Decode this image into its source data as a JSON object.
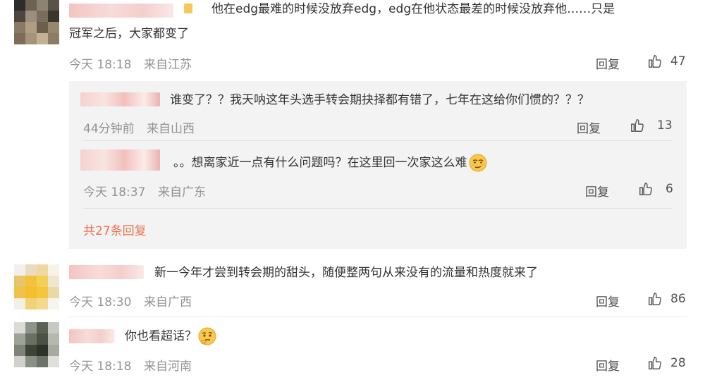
{
  "comments": [
    {
      "text_line1": "他在edg最难的时候没放弃edg，edg在他状态最差的时候没放弃他……只是",
      "text_line2": "冠军之后，大家都变了",
      "time": "今天 18:18",
      "location": "来自江苏",
      "reply_label": "回复",
      "likes": "47",
      "avatar_colors": [
        "#2c2c2c",
        "#6e6252",
        "#8c8373",
        "#5a5248",
        "#4d463e",
        "#9a8f7d",
        "#7a6d5e",
        "#3a352f",
        "#8a7a64",
        "#b09d82",
        "#6d5d4d",
        "#98876f",
        "#7d6c58",
        "#a59479",
        "#c2b194",
        "#8e7d66"
      ],
      "replies": [
        {
          "text": "谁变了？？我天呐这年头选手转会期抉择都有错了，七年在这给你们惯的？？？",
          "time": "44分钟前",
          "location": "来自山西",
          "reply_label": "回复",
          "likes": "13"
        },
        {
          "text": "。。想离家近一点有什么问题吗？在这里回一次家这么难",
          "emoji": "smirk-emoji",
          "time": "今天 18:37",
          "location": "来自广东",
          "reply_label": "回复",
          "likes": "6"
        }
      ],
      "more_replies": "共27条回复"
    },
    {
      "text": "新一今年才尝到转会期的甜头，随便整两句从来没有的流量和热度就来了",
      "time": "今天 18:30",
      "location": "来自广西",
      "reply_label": "回复",
      "likes": "86",
      "avatar_colors": [
        "#f2f0ea",
        "#e8dcc0",
        "#f0d9a0",
        "#f6f2e8",
        "#e8c46a",
        "#f2c23c",
        "#f4cf56",
        "#efe6cf",
        "#efc24a",
        "#f3bf2e",
        "#f5c63c",
        "#ead9a8",
        "#f4f0e6",
        "#f0d278",
        "#f4d88c",
        "#f6f4ee"
      ]
    },
    {
      "text": "你也看超话？",
      "emoji": "thinking-emoji",
      "time": "今天 18:18",
      "location": "来自河南",
      "reply_label": "回复",
      "likes": "28",
      "avatar_colors": [
        "#dcdcd6",
        "#8e948a",
        "#5a6152",
        "#c7cac2",
        "#9ea399",
        "#6a7062",
        "#4b5145",
        "#b4b8ae",
        "#7f8576",
        "#3f4438",
        "#2e322a",
        "#a6aa9f",
        "#cfd1ca",
        "#8b9085",
        "#6e7367",
        "#dfe0db"
      ]
    }
  ],
  "colors": {
    "meta": "#939393",
    "link": "#eb7350",
    "sub_background": "#f3f3f3"
  }
}
